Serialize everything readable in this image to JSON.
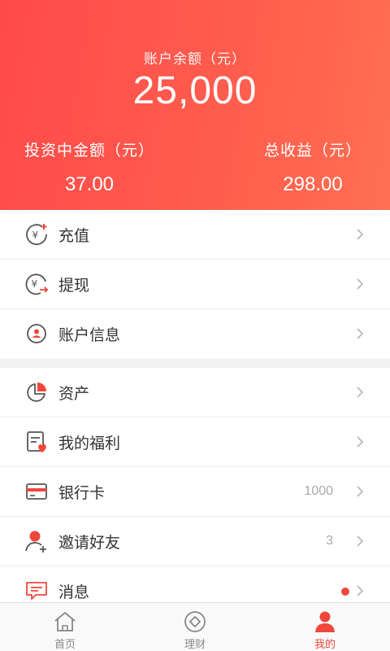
{
  "header": {
    "balance_label": "账户余额（元）",
    "balance_value": "25,000",
    "invest_label": "投资中金额（元）",
    "invest_value": "37.00",
    "income_label": "总收益（元）",
    "income_value": "298.00"
  },
  "group1": [
    {
      "label": "充值",
      "icon": "recharge-icon"
    },
    {
      "label": "提现",
      "icon": "withdraw-icon"
    },
    {
      "label": "账户信息",
      "icon": "account-info-icon"
    }
  ],
  "group2": [
    {
      "label": "资产",
      "icon": "pie-chart-icon"
    },
    {
      "label": "我的福利",
      "icon": "welfare-icon"
    },
    {
      "label": "银行卡",
      "icon": "bank-card-icon",
      "value": "1000"
    },
    {
      "label": "邀请好友",
      "icon": "invite-friend-icon",
      "value": "3"
    },
    {
      "label": "消息",
      "icon": "message-icon",
      "unread_dot": true
    }
  ],
  "tabbar": [
    {
      "label": "首页",
      "icon": "home-icon",
      "active": false
    },
    {
      "label": "理财",
      "icon": "finance-icon",
      "active": false
    },
    {
      "label": "我的",
      "icon": "profile-icon",
      "active": true
    }
  ],
  "colors": {
    "accent": "#f0463b",
    "header_start": "#ff4a4a",
    "header_end": "#ff6f52"
  }
}
